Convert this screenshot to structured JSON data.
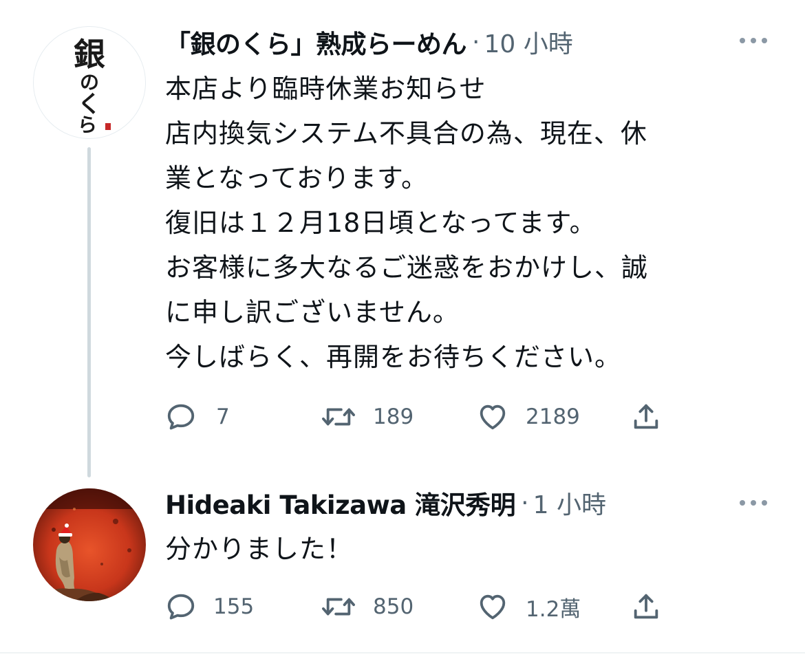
{
  "tweet1": {
    "avatar": {
      "logo_text": "銀のくら",
      "logo_chars": [
        "銀",
        "の",
        "く",
        "ら"
      ]
    },
    "name": "「銀のくら」熟成らーめん",
    "separator": "·",
    "time": "10 小時",
    "more_icon": "more-horizontal-icon",
    "lines": [
      "本店より臨時休業お知らせ",
      "店内換気システム不具合の為、現在、休",
      "業となっております。",
      "復旧は１２月18日頃となってます。",
      "お客様に多大なるご迷惑をおかけし、誠",
      "に申し訳ございません。",
      "今しばらく、再開をお待ちください。"
    ],
    "actions": {
      "reply": {
        "icon": "reply-icon",
        "count": "7"
      },
      "retweet": {
        "icon": "retweet-icon",
        "count": "189"
      },
      "like": {
        "icon": "heart-icon",
        "count": "2189"
      },
      "share": {
        "icon": "share-icon"
      }
    }
  },
  "tweet2": {
    "avatar": {
      "image": "person-on-red-background-with-santa-hat"
    },
    "name": "Hideaki Takizawa 滝沢秀明",
    "separator": "·",
    "time": "1 小時",
    "more_icon": "more-horizontal-icon",
    "lines": [
      "分かりました！"
    ],
    "actions": {
      "reply": {
        "icon": "reply-icon",
        "count": "155"
      },
      "retweet": {
        "icon": "retweet-icon",
        "count": "850"
      },
      "like": {
        "icon": "heart-icon",
        "count": "1.2萬"
      },
      "share": {
        "icon": "share-icon"
      }
    }
  },
  "colors": {
    "text": "#0f1419",
    "secondary": "#536471",
    "thread_line": "#cfd9de",
    "divider": "#eff3f4"
  }
}
